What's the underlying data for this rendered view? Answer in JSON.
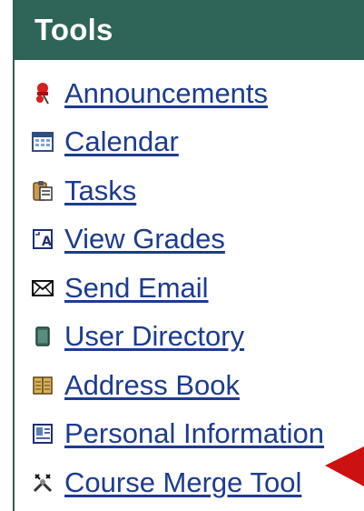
{
  "tools": {
    "title": "Tools",
    "items": [
      {
        "label": "Announcements",
        "icon": "pushpin-icon"
      },
      {
        "label": "Calendar",
        "icon": "calendar-icon"
      },
      {
        "label": "Tasks",
        "icon": "clipboard-icon"
      },
      {
        "label": "View Grades",
        "icon": "grades-icon"
      },
      {
        "label": "Send Email",
        "icon": "envelope-icon"
      },
      {
        "label": "User Directory",
        "icon": "directory-icon"
      },
      {
        "label": "Address Book",
        "icon": "address-book-icon"
      },
      {
        "label": "Personal Information",
        "icon": "id-card-icon"
      },
      {
        "label": "Course Merge Tool",
        "icon": "tools-icon"
      }
    ]
  },
  "colors": {
    "header_bg": "#2f6458",
    "link": "#1d3b8f",
    "arrow": "#cc1111"
  }
}
